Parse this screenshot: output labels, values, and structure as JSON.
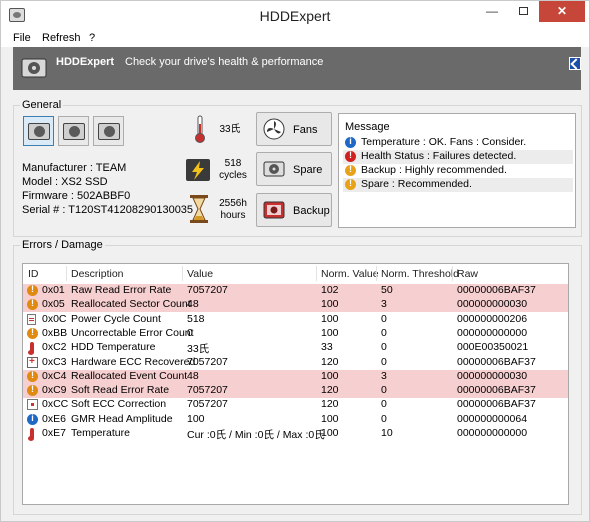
{
  "window": {
    "title": "HDDExpert"
  },
  "menu": [
    "File",
    "Refresh",
    "?"
  ],
  "banner": {
    "title": "HDDExpert",
    "tagline": "Check your drive's health & performance"
  },
  "general": {
    "label": "General",
    "manufacturer": "Manufacturer : TEAM",
    "model": "Model : XS2 SSD",
    "firmware": "Firmware : 502ABBF0",
    "serial": "Serial # : T120ST41208290130035",
    "temperature": "33氏",
    "cycles_value": "518",
    "cycles_unit": "cycles",
    "hours_value": "2556h",
    "hours_unit": "hours",
    "buttons": {
      "fans": "Fans",
      "spare": "Spare",
      "backup": "Backup"
    }
  },
  "message": {
    "title": "Message",
    "lines": [
      {
        "type": "info",
        "text": "Temperature : OK. Fans : Consider."
      },
      {
        "type": "error",
        "text": "Health Status : Failures detected."
      },
      {
        "type": "warn",
        "text": "Backup : Highly recommended."
      },
      {
        "type": "warn",
        "text": "Spare : Recommended."
      }
    ]
  },
  "errors": {
    "label": "Errors / Damage",
    "columns": [
      "ID",
      "Description",
      "Value",
      "Norm. Value",
      "Norm. Threshold",
      "Raw"
    ],
    "rows": [
      {
        "icon": "warn",
        "id": "0x01",
        "desc": "Raw Read Error Rate",
        "value": "7057207",
        "norm": "102",
        "thresh": "50",
        "raw": "00000006BAF37",
        "bad": true
      },
      {
        "icon": "warn",
        "id": "0x05",
        "desc": "Reallocated Sector Count",
        "value": "48",
        "norm": "100",
        "thresh": "3",
        "raw": "000000000030",
        "bad": true
      },
      {
        "icon": "doc",
        "id": "0x0C",
        "desc": "Power Cycle Count",
        "value": "518",
        "norm": "100",
        "thresh": "0",
        "raw": "000000000206",
        "bad": false
      },
      {
        "icon": "warn",
        "id": "0xBB",
        "desc": "Uncorrectable Error Count",
        "value": "0",
        "norm": "100",
        "thresh": "0",
        "raw": "000000000000",
        "bad": false
      },
      {
        "icon": "therm",
        "id": "0xC2",
        "desc": "HDD Temperature",
        "value": "33氏",
        "norm": "33",
        "thresh": "0",
        "raw": "000E00350021",
        "bad": false
      },
      {
        "icon": "chip",
        "id": "0xC3",
        "desc": "Hardware ECC Recovered",
        "value": "7057207",
        "norm": "120",
        "thresh": "0",
        "raw": "00000006BAF37",
        "bad": false
      },
      {
        "icon": "warn",
        "id": "0xC4",
        "desc": "Reallocated Event Count",
        "value": "48",
        "norm": "100",
        "thresh": "3",
        "raw": "000000000030",
        "bad": true
      },
      {
        "icon": "warn",
        "id": "0xC9",
        "desc": "Soft Read Error Rate",
        "value": "7057207",
        "norm": "120",
        "thresh": "0",
        "raw": "00000006BAF37",
        "bad": true
      },
      {
        "icon": "block",
        "id": "0xCC",
        "desc": "Soft ECC Correction",
        "value": "7057207",
        "norm": "120",
        "thresh": "0",
        "raw": "00000006BAF37",
        "bad": false
      },
      {
        "icon": "info",
        "id": "0xE6",
        "desc": "GMR Head Amplitude",
        "value": "100",
        "norm": "100",
        "thresh": "0",
        "raw": "000000000064",
        "bad": false
      },
      {
        "icon": "therm",
        "id": "0xE7",
        "desc": "Temperature",
        "value": "Cur :0氏 / Min :0氏 / Max :0氏",
        "norm": "100",
        "thresh": "10",
        "raw": "000000000000",
        "bad": false
      }
    ]
  }
}
